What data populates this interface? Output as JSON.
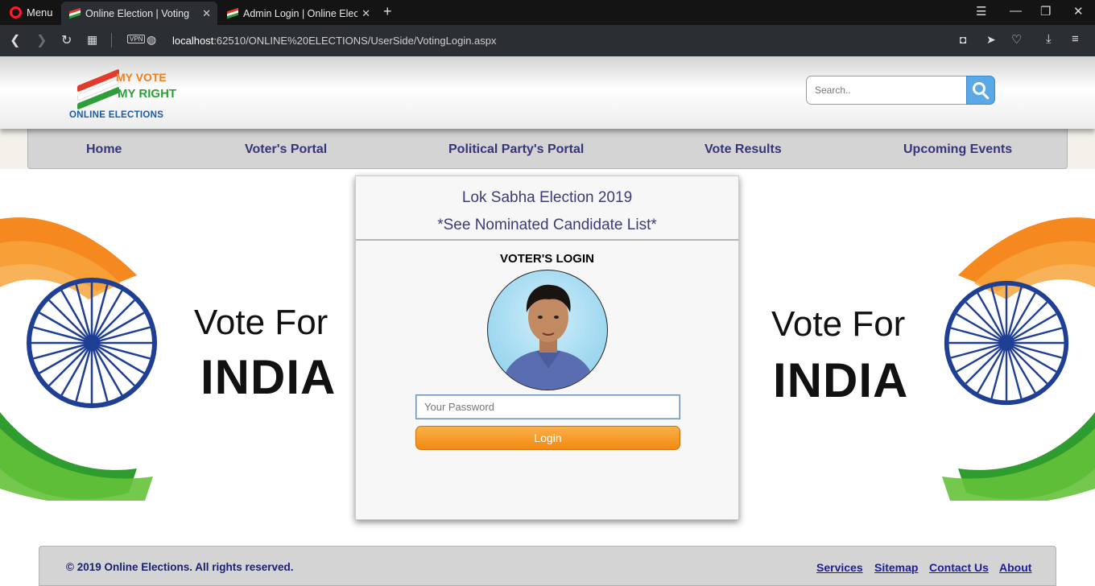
{
  "browser": {
    "menu_label": "Menu",
    "tabs": [
      {
        "title": "Online Election | Voting",
        "active": true
      },
      {
        "title": "Admin Login | Online Electi",
        "active": false
      }
    ],
    "url_host": "localhost",
    "url_rest": ":62510/ONLINE%20ELECTIONS/UserSide/VotingLogin.aspx",
    "vpn_label": "VPN"
  },
  "logo": {
    "line1": "MY VOTE",
    "line2": "MY RIGHT",
    "line3": "ONLINE ELECTIONS"
  },
  "search": {
    "placeholder": "Search.."
  },
  "nav": {
    "items": [
      "Home",
      "Voter's Portal",
      "Political Party's Portal",
      "Vote Results",
      "Upcoming Events"
    ]
  },
  "banner": {
    "line1": "Vote For",
    "line2": "INDIA"
  },
  "card": {
    "title": "Lok Sabha Election 2019",
    "subtitle": "*See Nominated Candidate List*",
    "heading": "VOTER'S LOGIN",
    "password_placeholder": "Your Password",
    "login_label": "Login"
  },
  "footer": {
    "copyright": "© 2019 Online Elections. All rights reserved.",
    "links": [
      "Services",
      "Sitemap",
      "Contact Us",
      "About"
    ]
  },
  "colors": {
    "saffron": "#f07f1d",
    "green": "#2e9e3a",
    "navy": "#1f3f94",
    "nav_text": "#35357a",
    "button_orange": "#f18a12"
  }
}
